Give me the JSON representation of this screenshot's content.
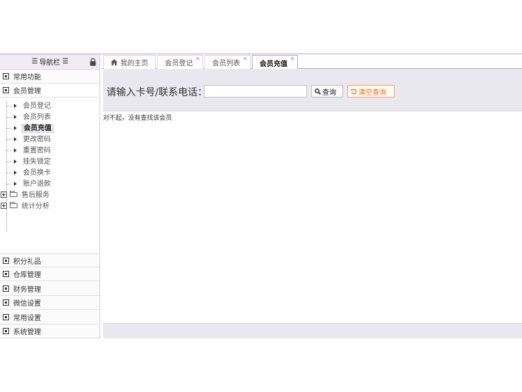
{
  "sidebar": {
    "header_title": "导航栏",
    "top_panels": [
      {
        "label": "常用功能",
        "icon": "collapse-icon"
      },
      {
        "label": "会员管理",
        "icon": "collapse-icon"
      }
    ],
    "tree_items": [
      {
        "label": "会员登记"
      },
      {
        "label": "会员列表"
      },
      {
        "label": "会员充值",
        "selected": true
      },
      {
        "label": "更改密码"
      },
      {
        "label": "重置密码"
      },
      {
        "label": "挂失锁定"
      },
      {
        "label": "会员换卡"
      },
      {
        "label": "账户退款"
      }
    ],
    "tree_groups": [
      {
        "label": "售后服务"
      },
      {
        "label": "统计分析"
      }
    ],
    "bottom_panels": [
      {
        "label": "积分礼品"
      },
      {
        "label": "仓库管理"
      },
      {
        "label": "财务管理"
      },
      {
        "label": "微信设置"
      },
      {
        "label": "常用设置"
      },
      {
        "label": "系统管理"
      }
    ]
  },
  "tabs": [
    {
      "label": "我的主页",
      "closable": false
    },
    {
      "label": "会员登记",
      "closable": true
    },
    {
      "label": "会员列表",
      "closable": true
    },
    {
      "label": "会员充值",
      "closable": true,
      "active": true
    }
  ],
  "search": {
    "label": "请输入卡号/联系电话：",
    "value": "",
    "query_button": "查询",
    "clear_button": "清空查询"
  },
  "message": "对不起，没有查找该会员",
  "colors": {
    "accent": "#b7a6d1",
    "toolbar_bg": "#eae8ef",
    "clear_button": "#e8701a"
  }
}
